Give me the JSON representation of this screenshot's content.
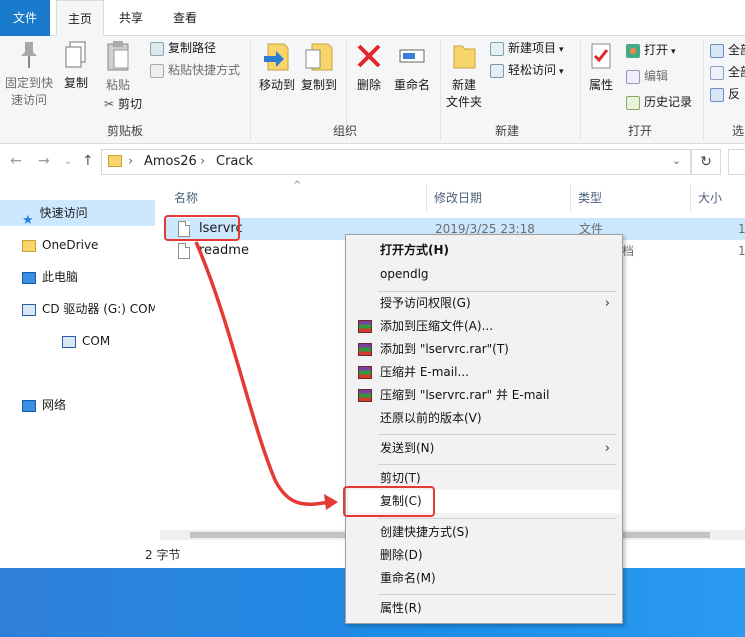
{
  "ribbon_tabs": {
    "file": "文件",
    "home": "主页",
    "share": "共享",
    "view": "查看"
  },
  "clipboard": {
    "pin": "固定到快\n速访问",
    "copy": "复制",
    "paste": "粘贴",
    "copy_path": "复制路径",
    "paste_shortcut": "粘贴快捷方式",
    "cut": "剪切",
    "label": "剪贴板"
  },
  "organize": {
    "move_to": "移动到",
    "copy_to": "复制到",
    "delete": "删除",
    "rename": "重命名",
    "label": "组织"
  },
  "new": {
    "new_folder": "新建\n文件夹",
    "new_item": "新建项目",
    "easy_access": "轻松访问",
    "label": "新建"
  },
  "open": {
    "properties": "属性",
    "open": "打开",
    "edit": "编辑",
    "history": "历史记录",
    "label": "打开"
  },
  "select": {
    "all": "全部",
    "all2": "全部",
    "invert": "反",
    "label": "选"
  },
  "address": {
    "path1": "Amos26",
    "path2": "Crack"
  },
  "nav": {
    "items": [
      "快速访问",
      "OneDrive",
      "此电脑",
      "CD 驱动器 (G:) COM",
      "COM",
      "网络"
    ]
  },
  "columns": {
    "name": "名称",
    "date": "修改日期",
    "type": "类型",
    "size": "大小"
  },
  "files": [
    {
      "name": "lservrc",
      "date": "2019/3/25 23:18",
      "type": "文件",
      "size": "1"
    },
    {
      "name": "readme",
      "date": "",
      "type": "档",
      "size": "1"
    }
  ],
  "status": {
    "text": "2 字节"
  },
  "context_menu": {
    "open_with": "打开方式(H)",
    "opendlg": "opendlg",
    "grant_access": "授予访问权限(G)",
    "add_archive": "添加到压缩文件(A)...",
    "add_rar": "添加到 \"lservrc.rar\"(T)",
    "compress_email": "压缩并 E-mail...",
    "compress_rar_email": "压缩到 \"lservrc.rar\" 并 E-mail",
    "restore": "还原以前的版本(V)",
    "send_to": "发送到(N)",
    "cut": "剪切(T)",
    "copy": "复制(C)",
    "create_shortcut": "创建快捷方式(S)",
    "delete": "删除(D)",
    "rename": "重命名(M)",
    "properties": "属性(R)"
  },
  "colors": {
    "accent": "#1979ca",
    "selection": "#cce8ff",
    "annotation": "#e53935"
  }
}
